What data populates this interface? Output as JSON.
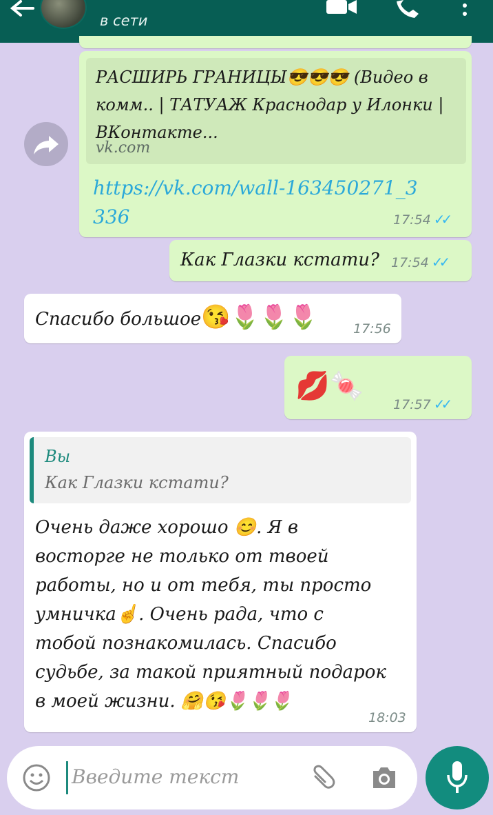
{
  "header": {
    "status": "в сети"
  },
  "messages": {
    "link_message": {
      "preview_title": "РАСШИРЬ ГРАНИЦЫ😎😎😎 (Видео в комм.. | ТАТУАЖ Краснодар у Илонки | ВКонтакте...",
      "preview_domain": "vk.com",
      "url": "https://vk.com/wall-163450271_3336",
      "time": "17:54"
    },
    "question": {
      "text": "Как Глазки кстати?",
      "time": "17:54"
    },
    "thanks": {
      "text": "Спасибо большое",
      "emojis": "😘🌷🌷🌷",
      "time": "17:56"
    },
    "emoji_message": {
      "emojis": "💋🍬",
      "time": "17:57"
    },
    "reply": {
      "quote_author": "Вы",
      "quote_text": "Как Глазки кстати?",
      "line1": "Очень даже хорошо 😊. Я в",
      "line2": "восторге не только от твоей",
      "line3": "работы, но и от тебя, ты просто",
      "line4": "умничка☝. Очень рада, что с",
      "line5": "тобой познакомилась. Спасибо",
      "line6": "судьбе, за такой приятный подарок",
      "line7": "в моей жизни. 🤗😘🌷🌷🌷",
      "time": "18:03"
    }
  },
  "input": {
    "placeholder": "Введите текст"
  },
  "icons": {
    "back": "back-arrow-icon",
    "video": "video-call-icon",
    "call": "phone-icon",
    "menu": "more-vert-icon",
    "forward": "forward-icon",
    "emoji": "emoji-icon",
    "attach": "paperclip-icon",
    "camera": "camera-icon",
    "mic": "microphone-icon"
  },
  "colors": {
    "header": "#075e54",
    "wallpaper": "#d9cfee",
    "outgoing_bubble": "#dcf8c6",
    "incoming_bubble": "#ffffff",
    "read_ticks": "#34b7f1",
    "mic_button": "#128c7e"
  }
}
